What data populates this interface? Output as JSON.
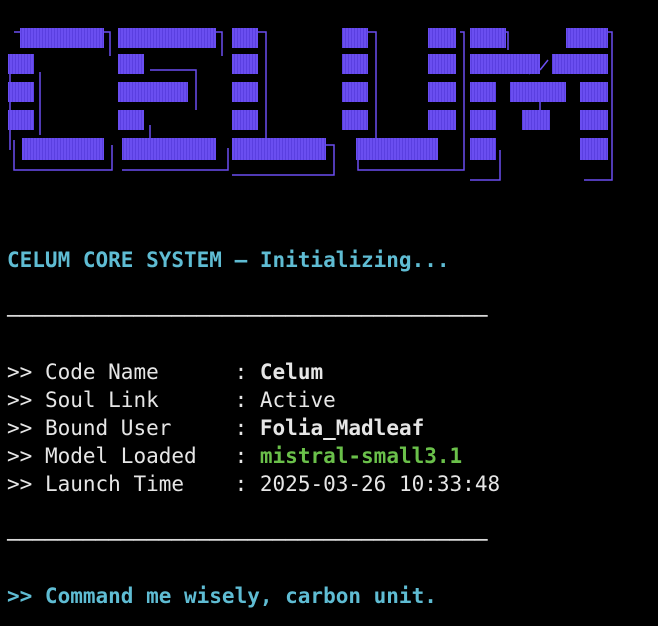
{
  "colors": {
    "background": "#000000",
    "logo_fill": "#6a4ef0",
    "logo_outline": "#6a4ef0",
    "heading": "#5fbcd3",
    "model_value": "#6ac04a",
    "text": "#e6e6e6"
  },
  "logo": {
    "text": "CELUM"
  },
  "status_line": "CELUM CORE SYSTEM — Initializing...",
  "separator": "──────────────────────────────────────",
  "info": [
    {
      "prefix": ">>",
      "label": "Code Name      ",
      "colon": ":",
      "value": "Celum",
      "style": "bold"
    },
    {
      "prefix": ">>",
      "label": "Soul Link      ",
      "colon": ":",
      "value": "Active",
      "style": "plain"
    },
    {
      "prefix": ">>",
      "label": "Bound User     ",
      "colon": ":",
      "value": "Folia_Madleaf",
      "style": "bold"
    },
    {
      "prefix": ">>",
      "label": "Model Loaded   ",
      "colon": ":",
      "value": "mistral-small3.1",
      "style": "green"
    },
    {
      "prefix": ">>",
      "label": "Launch Time    ",
      "colon": ":",
      "value": "2025-03-26 10:33:48",
      "style": "plain"
    }
  ],
  "prompt": ">> Command me wisely, carbon unit."
}
